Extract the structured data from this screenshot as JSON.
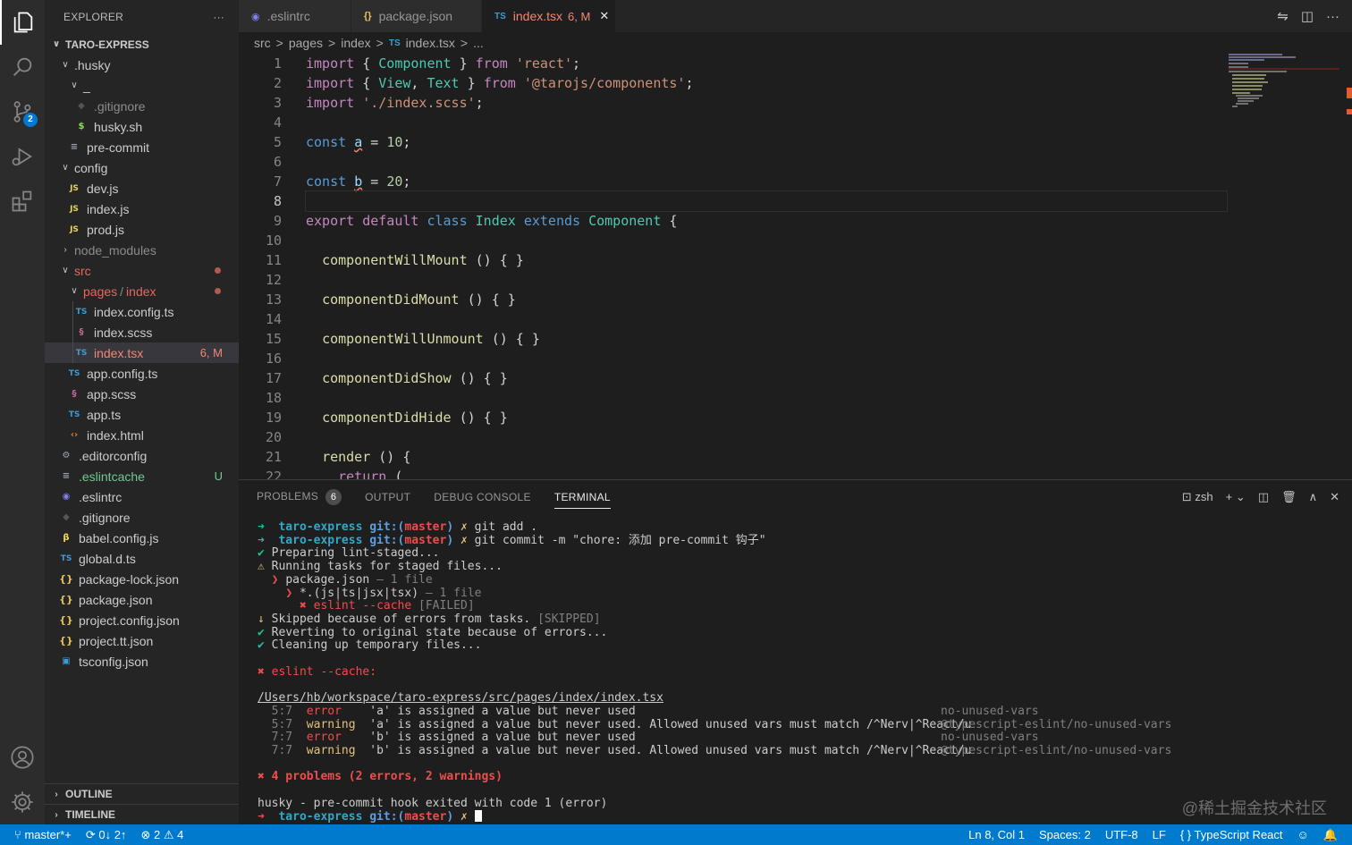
{
  "sidebar": {
    "header": "EXPLORER",
    "more": "···",
    "project": "TARO-EXPRESS",
    "tree": [
      {
        "label": "TARO-EXPRESS"
      },
      {
        "label": ".husky"
      },
      {
        "label": "_"
      },
      {
        "label": ".gitignore"
      },
      {
        "label": "husky.sh"
      },
      {
        "label": "pre-commit"
      },
      {
        "label": "config"
      },
      {
        "label": "dev.js"
      },
      {
        "label": "index.js"
      },
      {
        "label": "prod.js"
      },
      {
        "label": "node_modules"
      },
      {
        "label": "src"
      },
      {
        "label": "pages"
      },
      {
        "label": "index.config.ts"
      },
      {
        "label": "index.scss"
      },
      {
        "label": "index.tsx",
        "badge": "6, M"
      },
      {
        "label": "app.config.ts"
      },
      {
        "label": "app.scss"
      },
      {
        "label": "app.ts"
      },
      {
        "label": "index.html"
      },
      {
        "label": ".editorconfig"
      },
      {
        "label": ".eslintcache",
        "badge": "U"
      },
      {
        "label": ".eslintrc"
      },
      {
        "label": ".gitignore"
      },
      {
        "label": "babel.config.js"
      },
      {
        "label": "global.d.ts"
      },
      {
        "label": "package-lock.json"
      },
      {
        "label": "package.json"
      },
      {
        "label": "project.config.json"
      },
      {
        "label": "project.tt.json"
      },
      {
        "label": "tsconfig.json"
      }
    ],
    "pages_sep": "/",
    "pages_sub": "index",
    "outline": "OUTLINE",
    "timeline": "TIMELINE"
  },
  "activity": {
    "scm_badge": "2"
  },
  "tabs": [
    {
      "label": ".eslintrc",
      "icon": "◉"
    },
    {
      "label": "package.json",
      "icon": "{}"
    },
    {
      "label": "index.tsx",
      "icon": "TS",
      "badge": "6, M",
      "close": "✕"
    }
  ],
  "breadcrumb": {
    "parts": [
      "src",
      "pages",
      "index",
      "index.tsx",
      "..."
    ],
    "sep": ">",
    "ts": "TS"
  },
  "editor": {
    "lines": [
      "1",
      "2",
      "3",
      "4",
      "5",
      "6",
      "7",
      "8",
      "9",
      "10",
      "11",
      "12",
      "13",
      "14",
      "15",
      "16",
      "17",
      "18",
      "19",
      "20",
      "21",
      "22"
    ],
    "tokens": {
      "import": "import",
      "from": "from",
      "const": "const",
      "export": "export",
      "default": "default",
      "class": "class",
      "extends": "extends",
      "return": "return",
      "Component": "Component",
      "View": "View",
      "Text": "Text",
      "Index": "Index",
      "react": "'react'",
      "tarojs": "'@tarojs/components'",
      "scss": "'./index.scss'",
      "a": "a",
      "b": "b",
      "ten": "10",
      "twenty": "20",
      "cwm": "componentWillMount",
      "cdm": "componentDidMount",
      "cwu": "componentWillUnmount",
      "cds": "componentDidShow",
      "cdh": "componentDidHide",
      "render": "render"
    }
  },
  "panel": {
    "tabs": [
      "PROBLEMS",
      "OUTPUT",
      "DEBUG CONSOLE",
      "TERMINAL"
    ],
    "problems_count": "6",
    "shell": "zsh",
    "terminal": {
      "arrow": "➜",
      "dir": "taro-express",
      "git_label": "git:(",
      "branch": "master",
      "git_close": ")",
      "x": "✗",
      "cmd1": "git add .",
      "cmd2": "git commit -m \"chore: 添加 pre-commit 钩子\"",
      "l_prep": "Preparing lint-staged...",
      "l_running": "Running tasks for staged files...",
      "l_pkg": "package.json",
      "l_one_file": "— 1 file",
      "l_glob": "*.(js|ts|jsx|tsx)",
      "l_eslint": "eslint --cache",
      "l_failed": "[FAILED]",
      "l_skipped": "Skipped because of errors from tasks.",
      "l_skipped_tag": "[SKIPPED]",
      "l_revert": "Reverting to original state because of errors...",
      "l_cleanup": "Cleaning up temporary files...",
      "l_eslint_head": "eslint --cache:",
      "file_path": "/Users/hb/workspace/taro-express/src/pages/index/index.tsx",
      "issues": [
        {
          "pos": "5:7",
          "level": "error",
          "msg": "'a' is assigned a value but never used",
          "rule": "no-unused-vars"
        },
        {
          "pos": "5:7",
          "level": "warning",
          "msg": "'a' is assigned a value but never used. Allowed unused vars must match /^Nerv|^React/u",
          "rule": "@typescript-eslint/no-unused-vars"
        },
        {
          "pos": "7:7",
          "level": "error",
          "msg": "'b' is assigned a value but never used",
          "rule": "no-unused-vars"
        },
        {
          "pos": "7:7",
          "level": "warning",
          "msg": "'b' is assigned a value but never used. Allowed unused vars must match /^Nerv|^React/u",
          "rule": "@typescript-eslint/no-unused-vars"
        }
      ],
      "summary": "✖ 4 problems (2 errors, 2 warnings)",
      "husky": "husky - pre-commit hook exited with code 1 (error)"
    },
    "watermark": "@稀土掘金技术社区"
  },
  "status": {
    "branch": "master*+",
    "sync": "0↓ 2↑",
    "errors": "2",
    "warnings": "4",
    "position": "Ln 8, Col 1",
    "spaces": "Spaces: 2",
    "encoding": "UTF-8",
    "eol": "LF",
    "language": "TypeScript React"
  },
  "colors": {
    "accent": "#007acc",
    "activity_bg": "#2c2c2c",
    "sidebar_bg": "#252526",
    "editor_bg": "#1e1e1e"
  }
}
